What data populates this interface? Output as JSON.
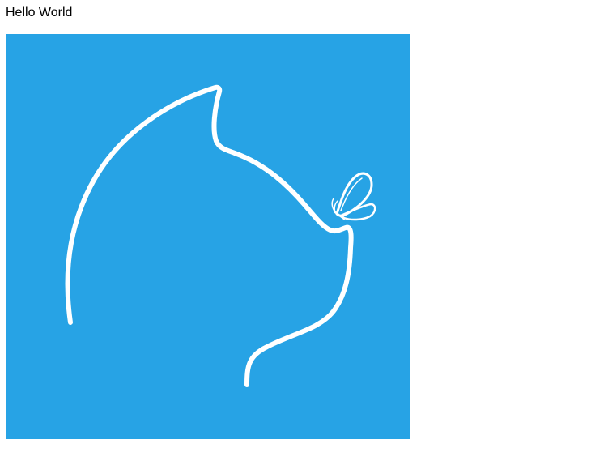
{
  "page": {
    "heading": "Hello World"
  },
  "image": {
    "subject_icon": "cat-outline-with-butterfly-icon",
    "background_color": "#27a3e5",
    "line_color": "#ffffff"
  }
}
